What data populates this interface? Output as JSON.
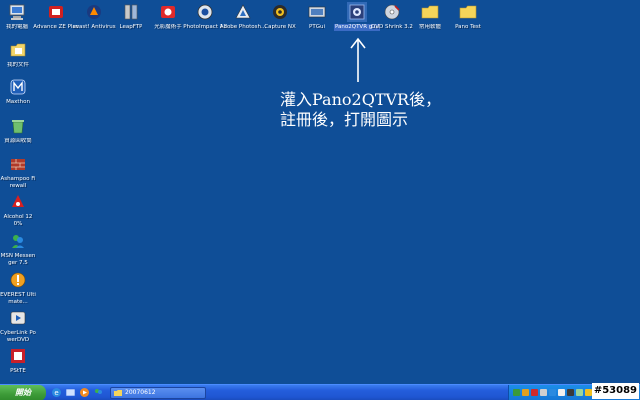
{
  "desktop": {
    "top_icons": [
      {
        "label": "我的電腦",
        "icon": "my-computer-icon"
      },
      {
        "label": "Advance ZE Plus",
        "icon": "advance-ze-icon"
      },
      {
        "label": "avast! Antivirus",
        "icon": "avast-icon"
      },
      {
        "label": "LeapFTP",
        "icon": "leapftp-icon"
      },
      {
        "label": "光影魔術手",
        "icon": "photo-magic-icon"
      },
      {
        "label": "PhotoImpact 11",
        "icon": "photoimpact-icon"
      },
      {
        "label": "Adobe Photosh...",
        "icon": "photoshop-icon"
      },
      {
        "label": "Capture NX",
        "icon": "capture-nx-icon"
      },
      {
        "label": "PTGui",
        "icon": "ptgui-icon"
      },
      {
        "label": "Pano2QTVR g ui",
        "icon": "pano2qtvr-icon",
        "selected": true
      },
      {
        "label": "DVD Shrink 3.2",
        "icon": "dvd-shrink-icon"
      },
      {
        "label": "常用軟體",
        "icon": "folder-icon"
      },
      {
        "label": "Pano Test",
        "icon": "folder-icon"
      }
    ],
    "left_icons": [
      {
        "label": "我的文件",
        "icon": "my-documents-icon"
      },
      {
        "label": "Maxthon",
        "icon": "maxthon-icon"
      },
      {
        "label": "資源回收筒",
        "icon": "recycle-bin-icon"
      },
      {
        "label": "Ashampoo Firewall",
        "icon": "firewall-icon"
      },
      {
        "label": "Alcohol 120%",
        "icon": "alcohol-icon"
      },
      {
        "label": "MSN Messenger 7.5",
        "icon": "msn-icon"
      },
      {
        "label": "EVEREST Ultimate...",
        "icon": "everest-icon"
      },
      {
        "label": "CyberLink PowerDVD",
        "icon": "powerdvd-icon"
      },
      {
        "label": "PStTE",
        "icon": "pstte-icon"
      }
    ]
  },
  "annotation": {
    "line1": "灌入Pano2QTVR後，",
    "line2": "註冊後，打開圖示"
  },
  "taskbar": {
    "start_label": "開始",
    "task_label": "20070612"
  },
  "watermark": "#53089",
  "colors": {
    "desktop_bg": "#0f4e97",
    "taskbar": "#245edc",
    "start": "#3c9a37",
    "tray": "#1577d6"
  }
}
